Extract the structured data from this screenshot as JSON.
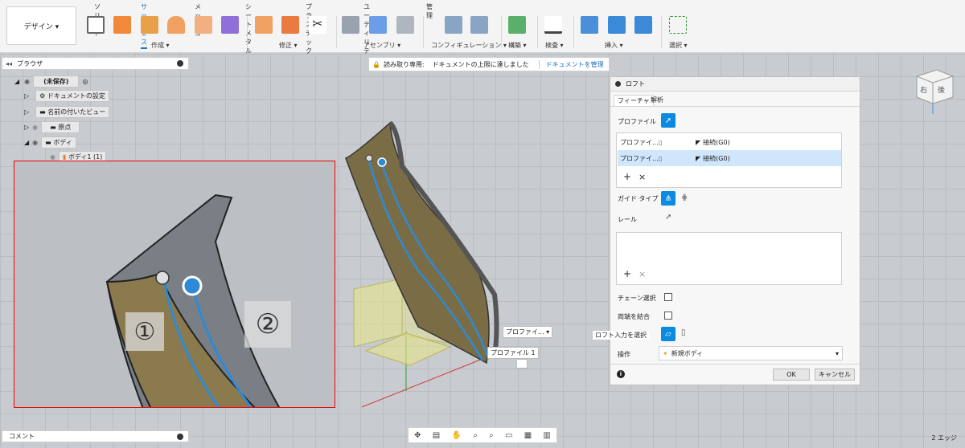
{
  "toolbar": {
    "design_label": "デザイン ▾",
    "tabs": [
      "ソリッド",
      "サーフェス",
      "メッシュ",
      "シートメタル",
      "プラスチック",
      "ユーティリティ",
      "管理"
    ],
    "groups": [
      "作成 ▾",
      "修正 ▾",
      "アセンブリ ▾",
      "コンフィギュレーション ▾",
      "構築 ▾",
      "検査 ▾",
      "挿入 ▾",
      "選択 ▾"
    ]
  },
  "browser": {
    "title": "ブラウザ",
    "items": [
      "(未保存)",
      "ドキュメントの設定",
      "名前の付いたビュー",
      "原点",
      "ボディ",
      "ボディ1 (1)"
    ]
  },
  "readonly_banner": {
    "label": "読み取り専用:",
    "message": "ドキュメントの上限に達しました",
    "link": "ドキュメントを管理"
  },
  "viewport": {
    "marker_1": "①",
    "marker_2": "②",
    "profile_tag_1": "プロファイ... ▾",
    "profile_tag_2": "プロファイル 1",
    "viewcube_front": "右",
    "viewcube_back": "後"
  },
  "loft": {
    "title": "ロフト",
    "tabs": [
      "フィーチャ",
      "解析"
    ],
    "profile_label": "プロファイル",
    "profiles": [
      {
        "name": "プロファイ...",
        "condition": "接続(G0)"
      },
      {
        "name": "プロファイ...",
        "condition": "接続(G0)"
      }
    ],
    "add": "+",
    "remove": "×",
    "guide_type": "ガイド タイプ",
    "rail": "レール",
    "chain_select": "チェーン選択",
    "merge_ends": "両端を結合",
    "loft_input": "ロフト入力を選択",
    "operation_label": "操作",
    "operation_value": "新規ボディ",
    "ok": "OK",
    "cancel": "キャンセル",
    "info": "i"
  },
  "comment": {
    "title": "コメント"
  },
  "status": "2 エッジ",
  "colors": {
    "accent": "#0a8ae0",
    "red": "#e00000",
    "surface": "#8a7a4e"
  }
}
